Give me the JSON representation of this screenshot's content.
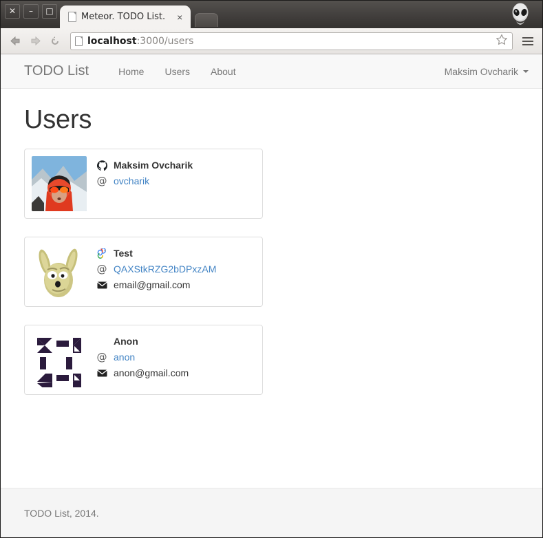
{
  "browser": {
    "window_controls": [
      {
        "name": "close",
        "glyph": "✕"
      },
      {
        "name": "minimize",
        "glyph": "–"
      },
      {
        "name": "maximize",
        "glyph": "□"
      }
    ],
    "tab": {
      "title": "Meteor. TODO List.",
      "close_glyph": "×",
      "favicon": "document-icon"
    },
    "new_tab_label": "",
    "profile_icon": "alien-avatar-icon",
    "toolbar": {
      "back_icon": "back-arrow-icon",
      "forward_icon": "forward-arrow-icon",
      "reload_icon": "reload-icon",
      "url_host": "localhost",
      "url_path": ":3000/users",
      "bookmark_icon": "star-icon",
      "menu_icon": "hamburger-menu-icon"
    }
  },
  "navbar": {
    "brand": "TODO List",
    "links": [
      {
        "label": "Home",
        "name": "home"
      },
      {
        "label": "Users",
        "name": "users"
      },
      {
        "label": "About",
        "name": "about"
      }
    ],
    "account": {
      "label": "Maksim Ovcharik",
      "caret_icon": "chevron-down-icon"
    }
  },
  "main": {
    "title": "Users",
    "users": [
      {
        "name": "Maksim Ovcharik",
        "service_icon": "github-icon",
        "username": "ovcharik",
        "at_icon": "at-icon",
        "email": null,
        "email_icon": "envelope-icon",
        "avatar": "photo-mountaineer"
      },
      {
        "name": "Test",
        "service_icon": "google-icon",
        "username": "QAXStkRZG2bDPxzAM",
        "at_icon": "at-icon",
        "email": "email@gmail.com",
        "email_icon": "envelope-icon",
        "avatar": "photo-donkey"
      },
      {
        "name": "Anon",
        "service_icon": null,
        "username": "anon",
        "at_icon": "at-icon",
        "email": "anon@gmail.com",
        "email_icon": "envelope-icon",
        "avatar": "identicon-purple"
      }
    ]
  },
  "footer": {
    "text": "TODO List, 2014."
  },
  "colors": {
    "link": "#4183c4",
    "muted": "#777777",
    "text": "#333333",
    "card_border": "#dddddd",
    "navbar_bg": "#f8f8f8",
    "footer_bg": "#f5f5f5",
    "identicon": "#2b1b3d"
  }
}
